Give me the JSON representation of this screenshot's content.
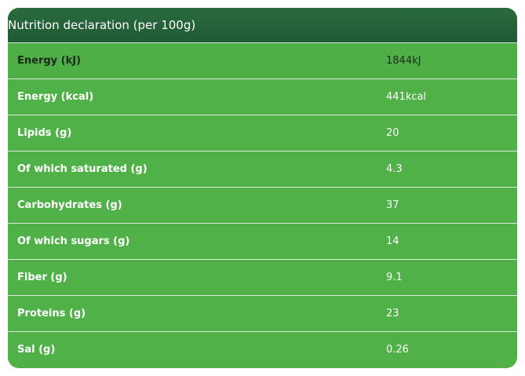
{
  "table": {
    "title": "Nutrition declaration (per 100g)",
    "rows": [
      {
        "label": "Energy (kJ)",
        "value": "1844kJ"
      },
      {
        "label": "Energy (kcal)",
        "value": "441kcal"
      },
      {
        "label": "Lipids (g)",
        "value": "20"
      },
      {
        "label": "Of which saturated (g)",
        "value": "4.3"
      },
      {
        "label": "Carbohydrates (g)",
        "value": "37"
      },
      {
        "label": "Of which sugars (g)",
        "value": "14"
      },
      {
        "label": "Fiber (g)",
        "value": "9.1"
      },
      {
        "label": "Proteins (g)",
        "value": "23"
      },
      {
        "label": "Sal (g)",
        "value": "0.26"
      }
    ]
  },
  "colors": {
    "header_bg": "#1f5a35",
    "row_bg": "#51b149",
    "divider": "#d9eed6"
  }
}
